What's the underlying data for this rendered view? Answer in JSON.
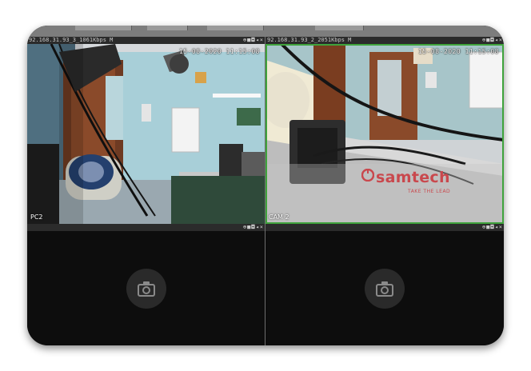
{
  "viewer": {
    "tiles": [
      {
        "title": "92.168.31.93_3_1061Kbps M",
        "timestamp": "15-08-2020 11:15:08",
        "camera_label": "PC2",
        "state": "live",
        "selected": false
      },
      {
        "title": "92.168.31.93_2_2051Kbps M",
        "timestamp": "15-08-2020 11:15:08",
        "camera_label": "CAM 2",
        "state": "live",
        "selected": true,
        "brand_name": "samtech",
        "brand_tagline": "TAKE THE LEAD"
      },
      {
        "title": "",
        "state": "empty",
        "selected": false
      },
      {
        "title": "",
        "state": "empty",
        "selected": false
      }
    ],
    "tile_tools": [
      "zoom-icon",
      "record-icon",
      "snapshot-icon",
      "audio-icon",
      "close-icon"
    ],
    "tool_glyphs": {
      "zoom": "⊕",
      "record": "■",
      "snapshot": "◘",
      "audio": "◂",
      "close": "×"
    },
    "colors": {
      "selected_border": "#3fa33c",
      "brand": "#c9484d",
      "background": "#0b0b0b"
    }
  }
}
